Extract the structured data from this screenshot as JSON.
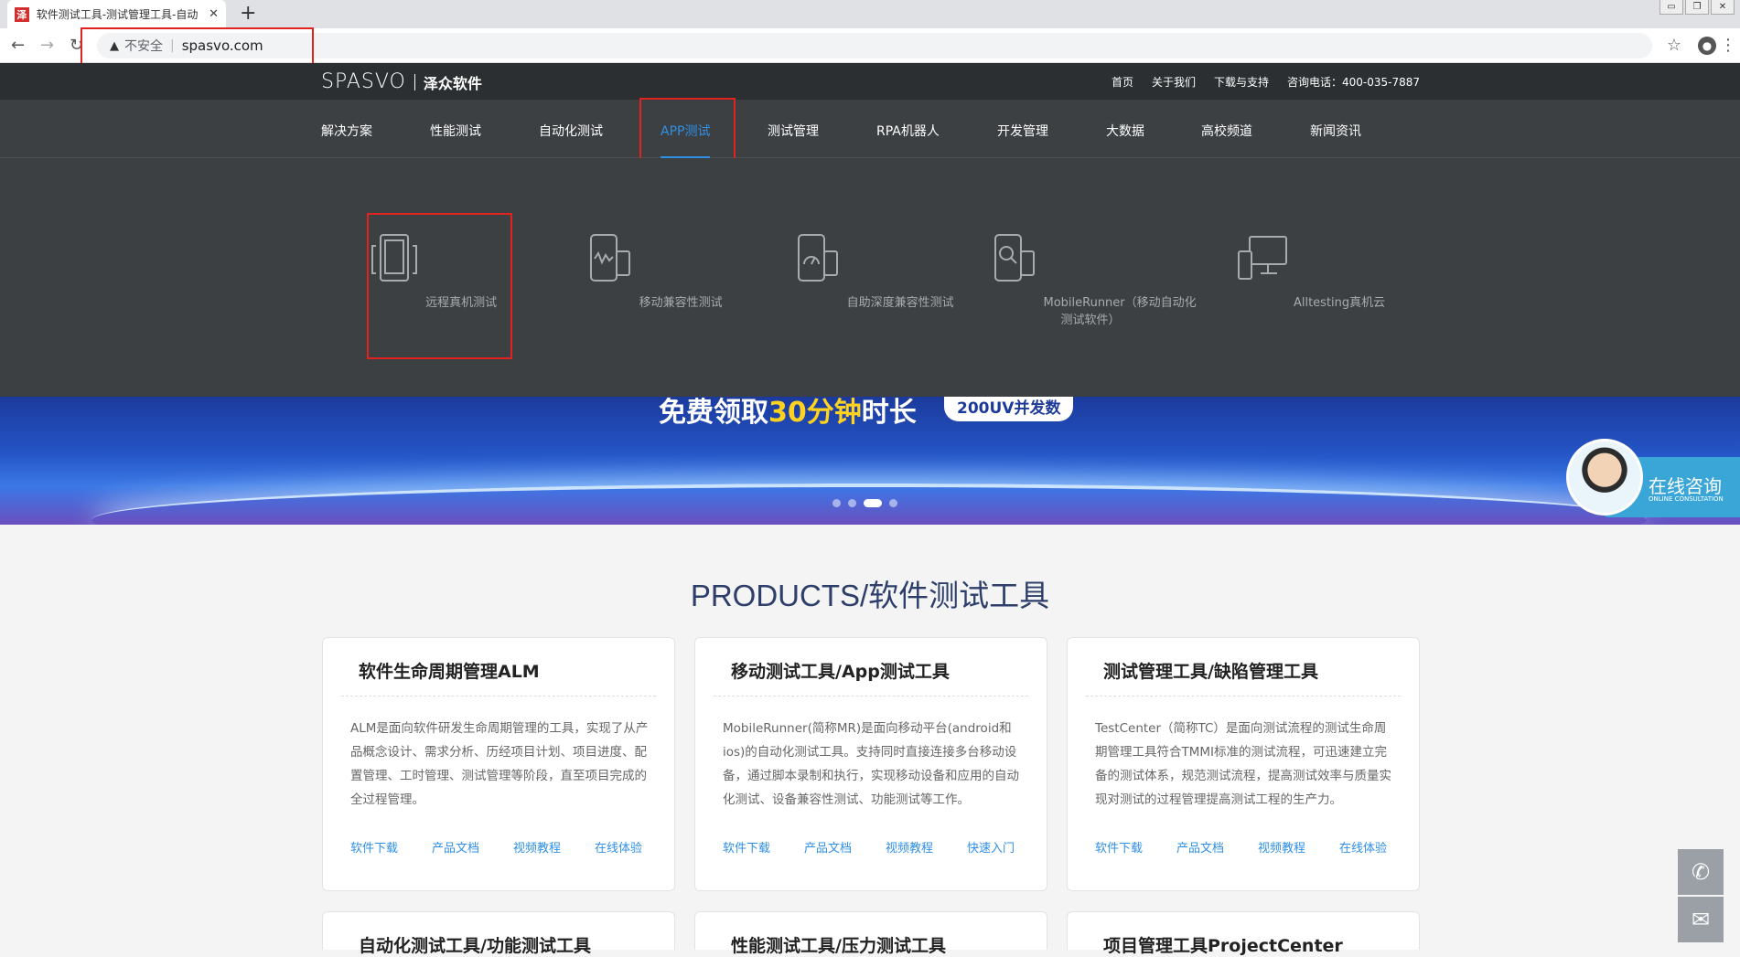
{
  "browser": {
    "tab_title": "软件测试工具-测试管理工具-自动",
    "favicon_text": "泽",
    "new_tab": "+",
    "close": "✕",
    "security_label": "不安全",
    "url": "spasvo.com"
  },
  "header": {
    "logo": "SPASVO",
    "logo_cn": "泽众软件",
    "top_links": [
      "首页",
      "关于我们",
      "下载与支持",
      "咨询电话：400-035-7887"
    ]
  },
  "nav": {
    "items": [
      "解决方案",
      "性能测试",
      "自动化测试",
      "APP测试",
      "测试管理",
      "RPA机器人",
      "开发管理",
      "大数据",
      "高校频道",
      "新闻资讯"
    ],
    "active": "APP测试"
  },
  "dropdown": {
    "items": [
      "远程真机测试",
      "移动兼容性测试",
      "自助深度兼容性测试",
      "MobileRunner（移动自动化测试软件）",
      "Alltesting真机云"
    ]
  },
  "banner": {
    "text_prefix": "免费领取",
    "text_highlight": "30分钟",
    "text_suffix": "时长",
    "pill": "200UV并发数",
    "consult_title": "在线咨询",
    "consult_sub": "ONLINE CONSULTATION"
  },
  "products": {
    "title": "PRODUCTS/软件测试工具",
    "cards": [
      {
        "title": "软件生命周期管理ALM",
        "desc": "ALM是面向软件研发生命周期管理的工具，实现了从产品概念设计、需求分析、历经项目计划、项目进度、配置管理、工时管理、测试管理等阶段，直至项目完成的全过程管理。",
        "links": [
          "软件下载",
          "产品文档",
          "视频教程",
          "在线体验"
        ]
      },
      {
        "title": "移动测试工具/App测试工具",
        "desc": "MobileRunner(简称MR)是面向移动平台(android和ios)的自动化测试工具。支持同时直接连接多台移动设备，通过脚本录制和执行，实现移动设备和应用的自动化测试、设备兼容性测试、功能测试等工作。",
        "links": [
          "软件下载",
          "产品文档",
          "视频教程",
          "快速入门"
        ]
      },
      {
        "title": "测试管理工具/缺陷管理工具",
        "desc": "TestCenter（简称TC）是面向测试流程的测试生命周期管理工具符合TMMI标准的测试流程，可迅速建立完备的测试体系，规范测试流程，提高测试效率与质量实现对测试的过程管理提高测试工程的生产力。",
        "links": [
          "软件下载",
          "产品文档",
          "视频教程",
          "在线体验"
        ]
      },
      {
        "title": "自动化测试工具/功能测试工具"
      },
      {
        "title": "性能测试工具/压力测试工具"
      },
      {
        "title": "项目管理工具ProjectCenter"
      }
    ]
  }
}
